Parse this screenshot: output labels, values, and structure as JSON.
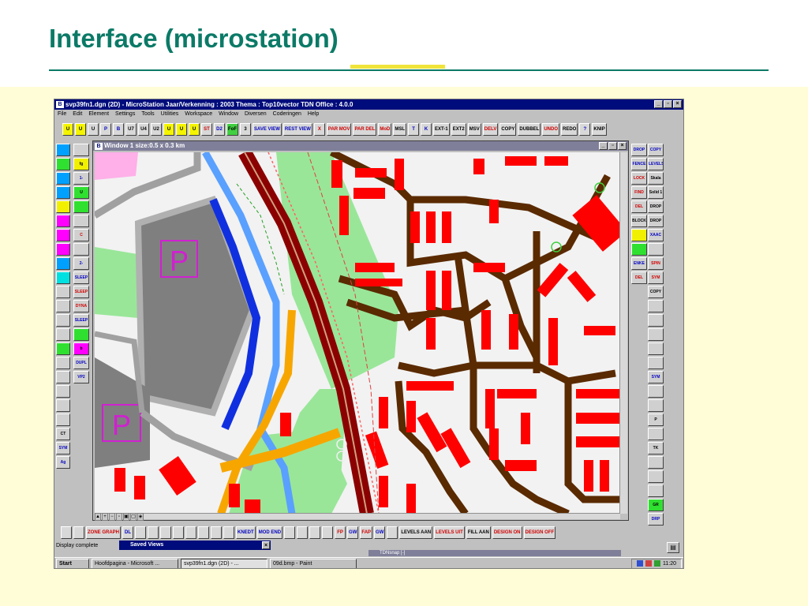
{
  "slide": {
    "title": "Interface  (microstation)"
  },
  "app": {
    "title": "svp39fn1.dgn (2D) - MicroStation  Jaar/Verkenning : 2003  Thema : Top10vector  TDN Office : 4.0.0",
    "menu": [
      "File",
      "Edit",
      "Element",
      "Settings",
      "Tools",
      "Utilities",
      "Workspace",
      "Window",
      "Diversen",
      "Coderingen",
      "Help"
    ],
    "map_window_title": "Window 1  size:0.5 x 0.3 km",
    "status": "Display complete",
    "saved_views": "Saved Views",
    "tdn_panel": "TDNsnap [-]",
    "taskbar": {
      "start": "Start",
      "tasks": [
        "Hoofdpagina - Microsoft ...",
        "svp39fn1.dgn (2D) - ...",
        "09d.bmp - Paint"
      ],
      "clock": "11:20"
    },
    "top_toolbar": [
      "U",
      "U",
      "U",
      "P",
      "B",
      "U7",
      "U4",
      "U2",
      "U",
      "U",
      "U",
      "ST",
      "D2",
      "FoF",
      "3",
      "SAVE VIEW",
      "REST VIEW",
      "X",
      "PAR MOV",
      "PAR DEL",
      "MoD",
      "MSL",
      "T",
      "K",
      "EXT-1",
      "EXT2",
      "MSV",
      "DELV",
      "COPY",
      "DUBBEL",
      "UNDO",
      "REDO",
      "?",
      "KNIP"
    ],
    "right_col1": [
      "DROP FENCE",
      "FENCE",
      "LOCK",
      "FIND ERR",
      "DEL ERR.",
      "BLOCK",
      "",
      "",
      "ENKE FENCE",
      "DEL FENCE"
    ],
    "right_col2": [
      "COPY",
      "LEVELS",
      "Skala 22",
      "Solid 1",
      "DROP",
      "DROP",
      "XAAC",
      "",
      "SPIN",
      "SYM HLP",
      "COPY SPIN",
      "",
      "",
      "",
      "",
      "",
      "SYM",
      "",
      "",
      "P",
      "",
      "TK",
      "",
      "",
      "",
      "GR",
      "DRP"
    ],
    "left_col1": [
      "",
      "",
      "",
      "",
      "",
      "",
      "",
      "",
      "",
      "",
      "",
      "",
      "",
      "",
      "",
      "",
      "",
      "",
      "",
      "",
      "CT",
      "SYM",
      "Ag"
    ],
    "left_col2": [
      "",
      "fg",
      "1-PUNT",
      "U",
      "",
      "",
      "C",
      "",
      "2-PUNT",
      "SLEEP",
      "SLEEP",
      "DYNA",
      "SLEEP",
      "",
      "b",
      "DUPL",
      "VP2"
    ],
    "bottom_toolbar": [
      "",
      "",
      "ZONE GRAPH",
      "DL",
      "",
      "",
      "",
      "",
      "",
      "",
      "",
      "",
      "KNEDT",
      "MOD END",
      "",
      "",
      "",
      "",
      "FP",
      "GW",
      "FAP",
      "GW",
      "",
      "LEVELS AAN",
      "LEVELS UIT",
      "FILL AAN",
      "DESIGN ON",
      "DESIGN OFF"
    ]
  },
  "colors": {
    "title": "#0b7a67",
    "slide_bg": "#fffdd8",
    "building": "#ff0000",
    "road": "#5a2a00",
    "railway": "#8b0000",
    "water": "#1030e0",
    "green": "#99e699",
    "parking": "#7f7f7f"
  }
}
